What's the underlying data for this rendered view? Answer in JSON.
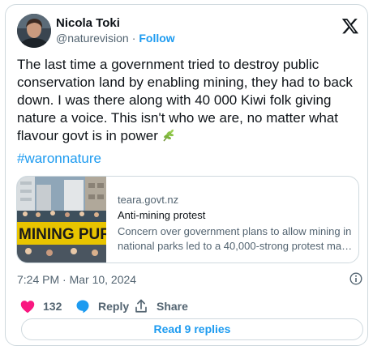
{
  "author": {
    "name": "Nicola Toki",
    "handle": "@naturevision",
    "separator": "·",
    "follow_label": "Follow"
  },
  "tweet": {
    "text": "The last time a government tried to destroy public conservation land by enabling mining, they had to back down. I was there along with 40 000 Kiwi folk giving nature a voice. This isn't who we are, no matter what flavour govt is in power",
    "emoji_icon": "herb-leaf-icon",
    "hashtag": "#waronnature"
  },
  "link_card": {
    "domain": "teara.govt.nz",
    "title": "Anti-mining protest",
    "description_line1": "Concern over government plans to allow mining in",
    "description_line2": "national parks led to a 40,000-strong protest marc...",
    "banner_text": "MINING PUR"
  },
  "meta": {
    "timestamp": "7:24 PM · Mar 10, 2024"
  },
  "actions": {
    "like_count": "132",
    "reply_label": "Reply",
    "share_label": "Share"
  },
  "footer": {
    "read_replies_label": "Read 9 replies"
  },
  "colors": {
    "accent": "#1d9bf0",
    "like": "#f91880",
    "muted": "#536471",
    "border": "#cfd9de"
  }
}
